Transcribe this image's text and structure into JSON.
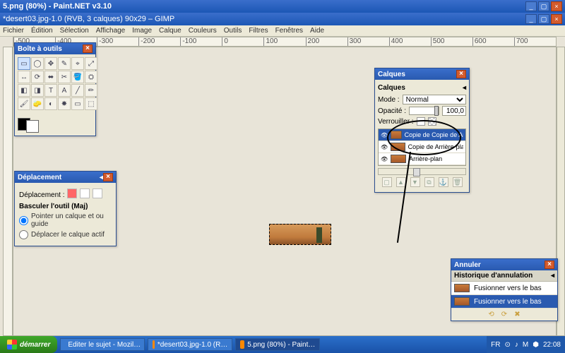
{
  "paintnet_title": "5.png (80%) - Paint.NET v3.10",
  "gimp_title": "*desert03.jpg-1.0 (RVB, 3 calques) 90x29 – GIMP",
  "menu": [
    "Fichier",
    "Édition",
    "Sélection",
    "Affichage",
    "Image",
    "Calque",
    "Couleurs",
    "Outils",
    "Filtres",
    "Fenêtres",
    "Aide"
  ],
  "ruler_marks": [
    "-500",
    "-400",
    "-300",
    "-200",
    "-100",
    "0",
    "100",
    "200",
    "300",
    "400",
    "500",
    "600",
    "700"
  ],
  "toolbox": {
    "title": "Boîte à outils",
    "tools": [
      "▭",
      "◯",
      "✥",
      "✎",
      "⌖",
      "⤢",
      "↔",
      "⟳",
      "⬌",
      "✂",
      "🪣",
      "⛭",
      "◧",
      "◨",
      "T",
      "A",
      "╱",
      "✏",
      "🖌",
      "🧽",
      "◐",
      "✸",
      "▭",
      "⬚"
    ]
  },
  "tool_options": {
    "title": "Déplacement",
    "label_deplacement": "Déplacement :",
    "label_basculer": "Basculer l'outil  (Maj)",
    "radio1": "Pointer un calque et ou guide",
    "radio2": "Déplacer le calque actif"
  },
  "layers": {
    "title": "Calques",
    "sub": "Calques",
    "mode_label": "Mode :",
    "mode_value": "Normal",
    "opacity_label": "Opacité :",
    "opacity_value": "100,0",
    "lock_label": "Verrouiller :",
    "items": [
      {
        "name": "Copie de Copie de Arrière-plan"
      },
      {
        "name": "Copie de Arrière-plan"
      },
      {
        "name": "Arrière-plan"
      }
    ]
  },
  "history": {
    "title": "Annuler",
    "sub": "Historique d'annulation",
    "items": [
      {
        "name": "Fusionner vers le bas"
      },
      {
        "name": "Fusionner vers le bas"
      }
    ]
  },
  "taskbar": {
    "start": "démarrer",
    "items": [
      "Editer le sujet - Mozil…",
      "*desert03.jpg-1.0 (R…",
      "5.png (80%) - Paint…"
    ],
    "lang": "FR",
    "clock": "22:08"
  }
}
